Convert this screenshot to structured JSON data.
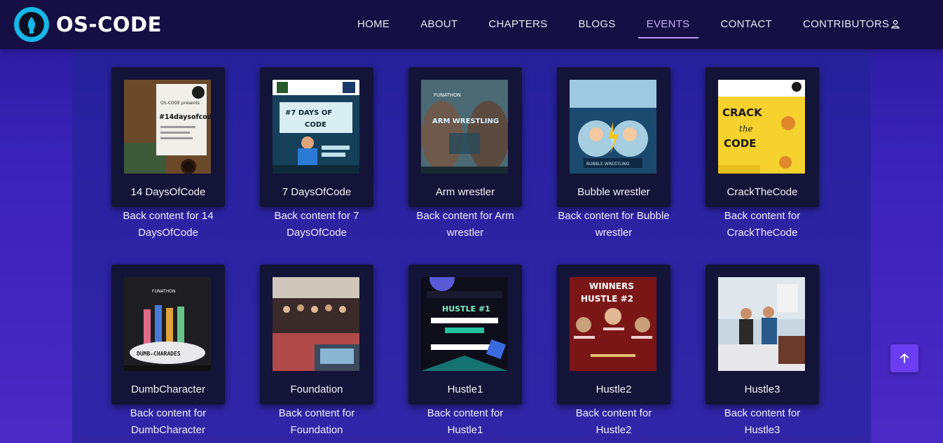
{
  "brand": {
    "name": "OS-CODE"
  },
  "nav": {
    "items": [
      {
        "label": "HOME"
      },
      {
        "label": "ABOUT"
      },
      {
        "label": "CHAPTERS"
      },
      {
        "label": "BLOGS"
      },
      {
        "label": "EVENTS",
        "active": true
      },
      {
        "label": "CONTACT"
      },
      {
        "label": "CONTRIBUTORS"
      }
    ],
    "user_icon": "user-icon"
  },
  "events": [
    {
      "title": "14 DaysOfCode",
      "back": "Back content for 14 DaysOfCode",
      "image": "event-poster-14-days-of-code"
    },
    {
      "title": "7 DaysOfCode",
      "back": "Back content for 7 DaysOfCode",
      "image": "event-poster-7-days-of-code"
    },
    {
      "title": "Arm wrestler",
      "back": "Back content for Arm wrestler",
      "image": "event-poster-arm-wrestling"
    },
    {
      "title": "Bubble wrestler",
      "back": "Back content for Bubble wrestler",
      "image": "event-poster-bubble-wrestling"
    },
    {
      "title": "CrackTheCode",
      "back": "Back content for CrackTheCode",
      "image": "event-poster-crack-the-code"
    },
    {
      "title": "DumbCharacter",
      "back": "Back content for DumbCharacter",
      "image": "event-poster-dumb-charades"
    },
    {
      "title": "Foundation",
      "back": "Back content for Foundation",
      "image": "event-photo-foundation"
    },
    {
      "title": "Hustle1",
      "back": "Back content for Hustle1",
      "image": "event-poster-hustle-1"
    },
    {
      "title": "Hustle2",
      "back": "Back content for Hustle2",
      "image": "event-poster-hustle-2-winners"
    },
    {
      "title": "Hustle3",
      "back": "Back content for Hustle3",
      "image": "event-photo-hustle-3"
    }
  ],
  "poster_text": {
    "p14": {
      "line1": "OS-CODE presents",
      "line2": "#14daysofcode"
    },
    "p7": {
      "line1": "#7 DAYS OF",
      "line2": "CODE"
    },
    "arm": {
      "line1": "FUNATHON",
      "line2": "ARM WRESTLING"
    },
    "bubble": {
      "line1": "BUBBLE WRESTLING"
    },
    "crack": {
      "line1": "CRACK",
      "line2": "the",
      "line3": "CODE"
    },
    "dumb": {
      "line1": "FUNATHON",
      "line2": "DUMB-CHARADES"
    },
    "h1": {
      "line1": "HUSTLE #1"
    },
    "h2": {
      "line1": "WINNERS",
      "line2": "HUSTLE #2"
    }
  },
  "scroll_top_icon": "arrow-up-icon",
  "colors": {
    "accent": "#6a3ef0",
    "nav_bg": "#140e3c",
    "brand_circle": "#17b7ea",
    "active_link": "#c8aef8",
    "card_bg": "#141438"
  }
}
